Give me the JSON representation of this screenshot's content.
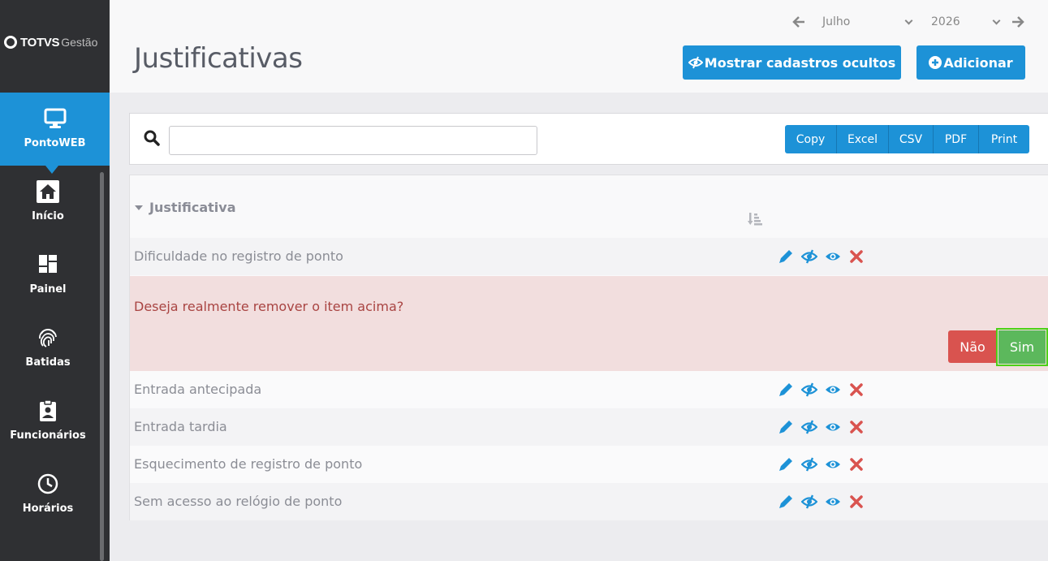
{
  "brand": {
    "totvs": "TOTVS",
    "gestao": "Gestão"
  },
  "sidebar": {
    "items": [
      {
        "label": "PontoWEB",
        "icon": "monitor-icon",
        "active": true
      },
      {
        "label": "Início",
        "icon": "home-icon"
      },
      {
        "label": "Painel",
        "icon": "dashboard-icon"
      },
      {
        "label": "Batidas",
        "icon": "fingerprint-icon"
      },
      {
        "label": "Funcionários",
        "icon": "id-badge-icon"
      },
      {
        "label": "Horários",
        "icon": "clock-icon"
      }
    ]
  },
  "header": {
    "title": "Justificativas",
    "month": "Julho",
    "year": "2026",
    "show_hidden_label": "Mostrar cadastros ocultos",
    "add_label": "Adicionar"
  },
  "search": {
    "value": "",
    "placeholder": ""
  },
  "export_buttons": [
    "Copy",
    "Excel",
    "CSV",
    "PDF",
    "Print"
  ],
  "table": {
    "group_header": "Justificativa",
    "rows": [
      "Dificuldade no registro de ponto",
      "Entrada antecipada",
      "Entrada tardia",
      "Esquecimento de registro de ponto",
      "Sem acesso ao relógio de ponto"
    ]
  },
  "confirm": {
    "message": "Deseja realmente remover o item acima?",
    "no_label": "Não",
    "yes_label": "Sim"
  },
  "colors": {
    "primary": "#1d92d7",
    "danger": "#d9534f",
    "success": "#5cb85c",
    "sidebar": "#2f3033"
  }
}
